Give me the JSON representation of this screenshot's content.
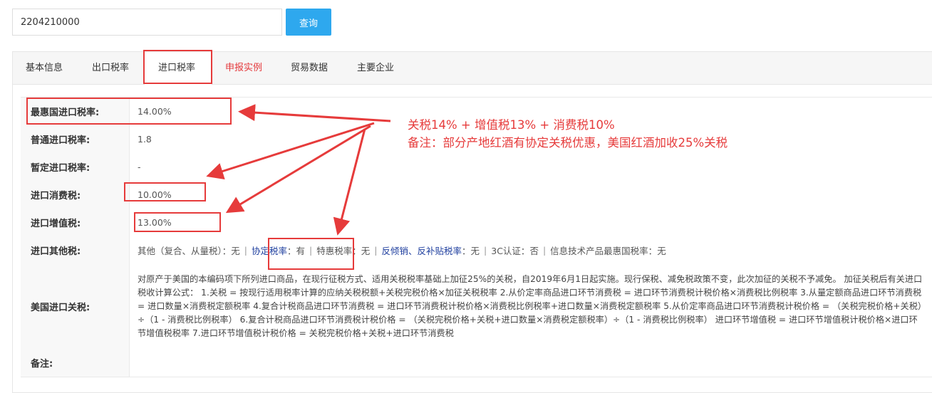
{
  "search": {
    "value": "2204210000",
    "button_label": "查询"
  },
  "tabs": [
    {
      "label": "基本信息"
    },
    {
      "label": "出口税率"
    },
    {
      "label": "进口税率"
    },
    {
      "label": "申报实例"
    },
    {
      "label": "贸易数据"
    },
    {
      "label": "主要企业"
    }
  ],
  "rates": {
    "mfn": {
      "label": "最惠国进口税率:",
      "value": "14.00%"
    },
    "general": {
      "label": "普通进口税率:",
      "value": "1.8"
    },
    "provisional": {
      "label": "暂定进口税率:",
      "value": "-"
    },
    "consumption": {
      "label": "进口消费税:",
      "value": "10.00%"
    },
    "vat": {
      "label": "进口增值税:",
      "value": "13.00%"
    },
    "other": {
      "label": "进口其他税:",
      "items": {
        "compound_label": "其他（复合、从量税）：",
        "compound_value": "无",
        "agreement_label": "协定税率",
        "agreement_value": "：有",
        "special_label": "特惠税率：",
        "special_value": "无",
        "antidumping_label": "反倾销、反补贴税率",
        "antidumping_value": "：无",
        "ccc_label": "3C认证：",
        "ccc_value": "否",
        "it_label": "信息技术产品最惠国税率：",
        "it_value": "无"
      }
    },
    "us_tariff": {
      "label": "美国进口关税:",
      "value": "对原产于美国的本编码项下所列进口商品，在现行征税方式、适用关税税率基础上加征25%的关税，自2019年6月1日起实施。现行保税、减免税政策不变，此次加征的关税不予减免。 加征关税后有关进口税收计算公式： 1.关税 = 按现行适用税率计算的应纳关税税额+关税完税价格×加征关税税率 2.从价定率商品进口环节消费税 = 进口环节消费税计税价格×消费税比例税率 3.从量定额商品进口环节消费税 = 进口数量×消费税定额税率 4.复合计税商品进口环节消费税 = 进口环节消费税计税价格×消费税比例税率+进口数量×消费税定额税率 5.从价定率商品进口环节消费税计税价格 = （关税完税价格+关税）÷（1 - 消费税比例税率） 6.复合计税商品进口环节消费税计税价格 = （关税完税价格+关税+进口数量×消费税定额税率）÷（1 - 消费税比例税率） 进口环节增值税 = 进口环节增值税计税价格×进口环节增值税税率 7.进口环节增值税计税价格 = 关税完税价格+关税+进口环节消费税"
    },
    "remark": {
      "label": "备注:",
      "value": ""
    }
  },
  "annotation": {
    "line1": "关税14% + 增值税13% + 消费税10%",
    "line2": "备注：部分产地红酒有协定关税优惠，美国红酒加收25%关税",
    "color": "#e63b3b"
  },
  "colors": {
    "accent": "#2ea8ee",
    "highlight": "#e63b3b",
    "link": "#1e3e9e"
  }
}
